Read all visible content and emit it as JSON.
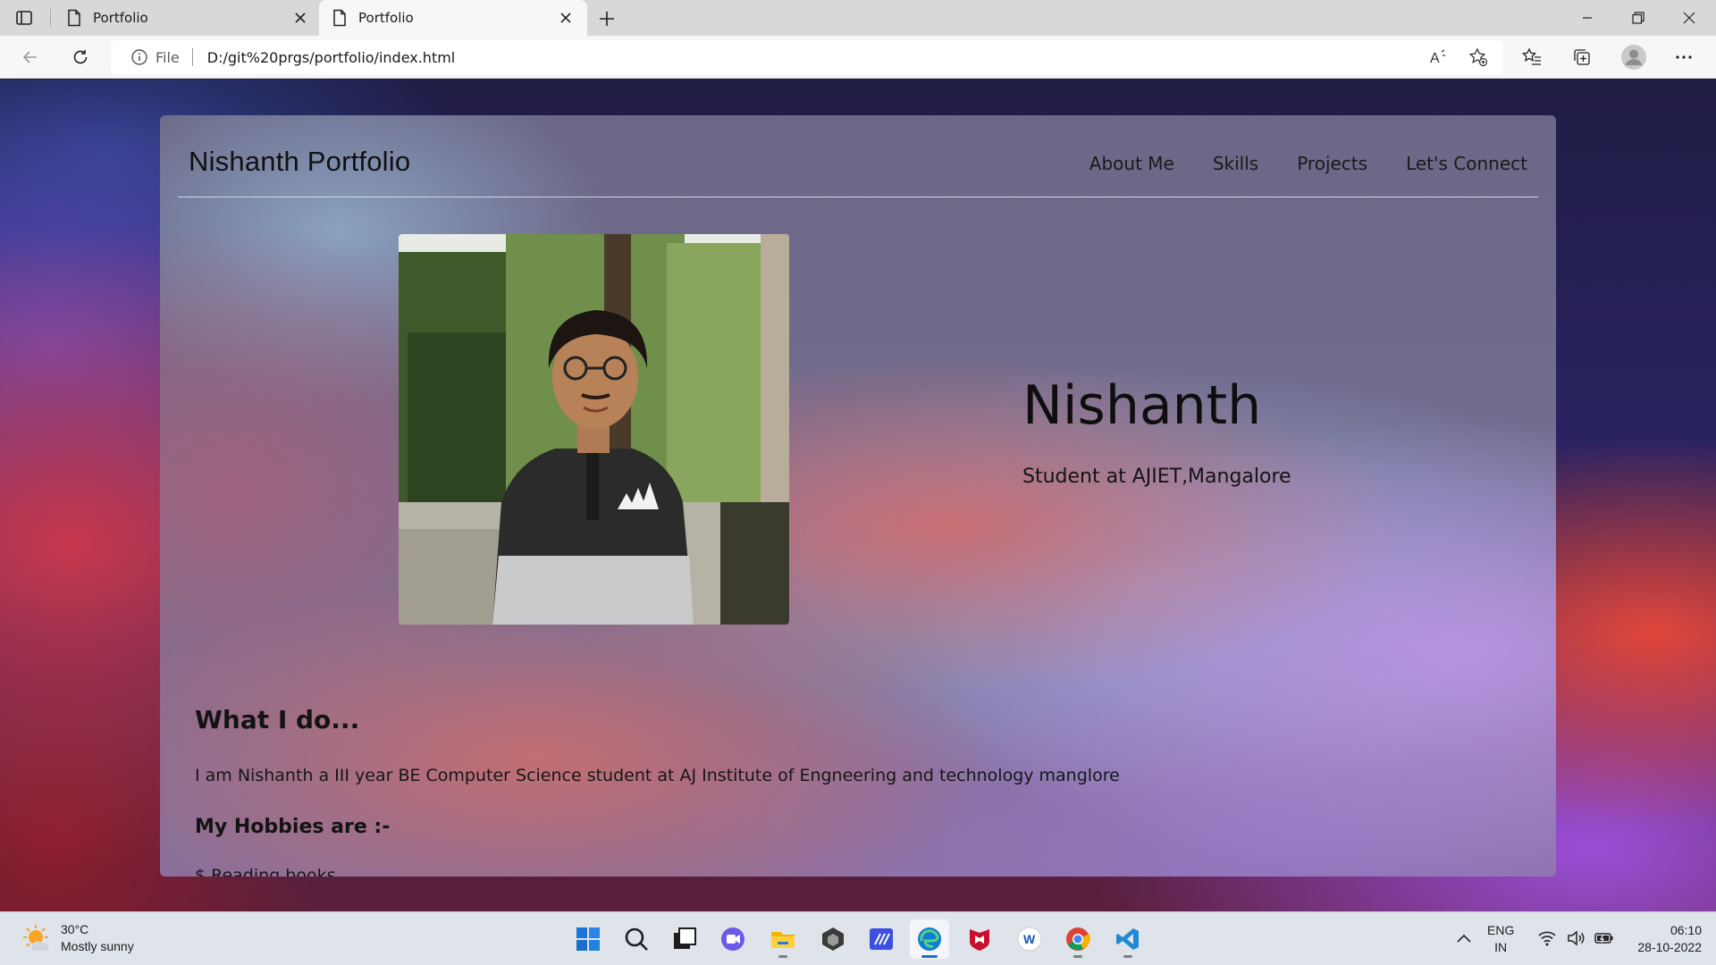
{
  "browser": {
    "tabs": [
      {
        "title": "Portfolio",
        "active": false
      },
      {
        "title": "Portfolio",
        "active": true
      }
    ],
    "address": {
      "scheme": "File",
      "url": "D:/git%20prgs/portfolio/index.html"
    },
    "icons": [
      "tab-actions-icon",
      "page-icon",
      "close-icon",
      "plus-icon",
      "minimize-icon",
      "restore-icon",
      "back-icon",
      "reload-icon",
      "info-icon",
      "read-aloud-icon",
      "add-favorite-icon",
      "favorites-icon",
      "collections-icon",
      "profile-icon",
      "more-icon"
    ]
  },
  "site": {
    "brand": "Nishanth Portfolio",
    "nav": [
      "About Me",
      "Skills",
      "Projects",
      "Let's Connect"
    ],
    "hero": {
      "name": "Nishanth",
      "subtitle": "Student at AJIET,Mangalore"
    },
    "about": {
      "heading": "What I do...",
      "text": "I am Nishanth a III year BE Computer Science student at AJ Institute of Engneering and technology manglore",
      "hobbies_heading": "My Hobbies are :-",
      "hobbies": [
        "$ Reading books"
      ]
    }
  },
  "taskbar": {
    "weather": {
      "temp": "30°C",
      "condition": "Mostly sunny"
    },
    "apps": [
      "start",
      "search",
      "task-view",
      "chat",
      "file-explorer",
      "unity",
      "code-app",
      "edge",
      "mcafee",
      "word",
      "chrome",
      "vscode"
    ],
    "active_app": "edge",
    "language": {
      "line1": "ENG",
      "line2": "IN"
    },
    "clock": {
      "time": "06:10",
      "date": "28-10-2022"
    }
  },
  "colors": {
    "accent": "#1f6fc2",
    "text": "#111111",
    "card_border": "#e8e8ee"
  }
}
